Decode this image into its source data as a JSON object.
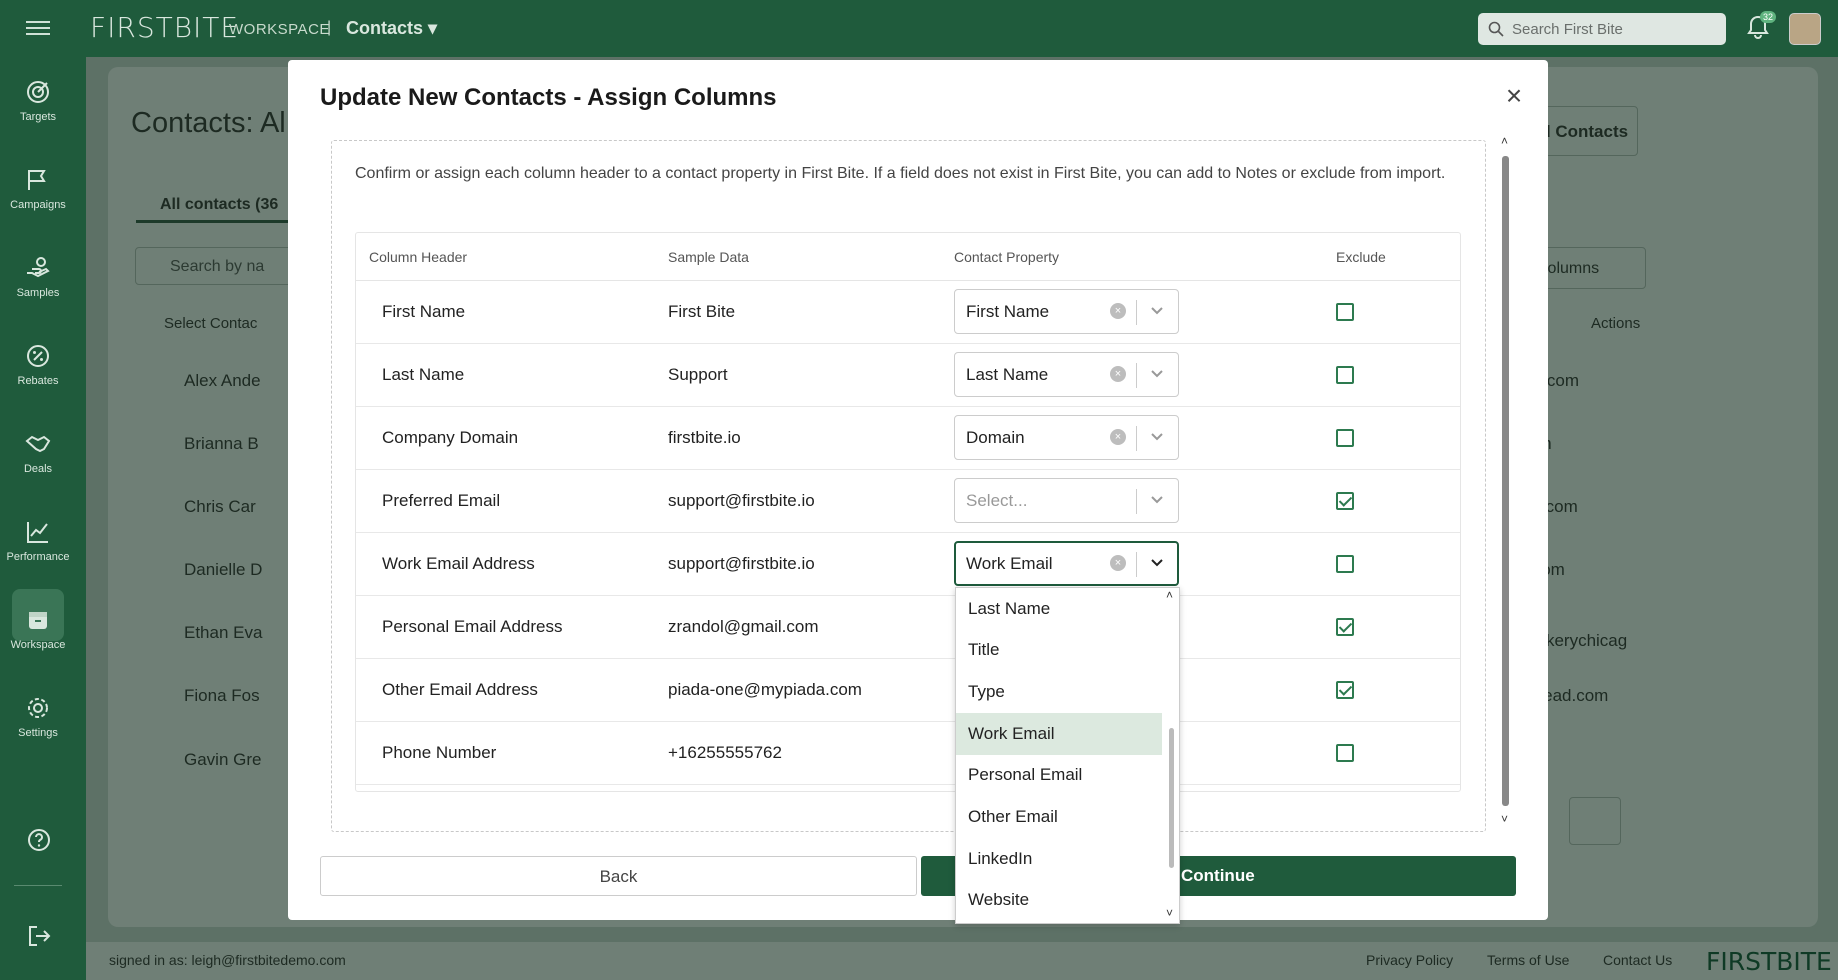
{
  "topbar": {
    "logo": "FIRSTBITE",
    "workspace_label": "WORKSPACE",
    "separator": "|",
    "context": "Contacts",
    "search_placeholder": "Search First Bite",
    "notification_count": "32"
  },
  "sidebar": {
    "items": [
      {
        "label": "Targets",
        "icon": "target-icon"
      },
      {
        "label": "Campaigns",
        "icon": "flag-icon"
      },
      {
        "label": "Samples",
        "icon": "hand-icon"
      },
      {
        "label": "Rebates",
        "icon": "percent-badge-icon"
      },
      {
        "label": "Deals",
        "icon": "handshake-icon"
      },
      {
        "label": "Performance",
        "icon": "chart-icon"
      },
      {
        "label": "Workspace",
        "icon": "archive-icon"
      },
      {
        "label": "Settings",
        "icon": "gear-icon"
      }
    ]
  },
  "background": {
    "page_title": "Contacts: Al",
    "add_contact_label": "tact",
    "upload_label": "Upload Contacts",
    "tab_all": "All contacts (36",
    "search_placeholder": "Search by na",
    "columns_label": "Columns",
    "select_contact": "Select Contac",
    "actions_header": "Actions",
    "names": [
      "Alex Ande",
      "Brianna B",
      "Chris Car",
      "Danielle D",
      "Ethan Eva",
      "Fiona Fos",
      "Gavin Gre"
    ],
    "emails": [
      "ut.com",
      "om",
      "ry.com",
      ".com",
      "cakerychicag",
      "bread.com",
      ""
    ],
    "footer_signed": "signed in as: leigh@firstbitedemo.com",
    "footer_links": [
      "Privacy Policy",
      "Terms of Use",
      "Contact Us"
    ],
    "footer_logo": "FIRSTBITE"
  },
  "modal": {
    "title": "Update New Contacts - Assign Columns",
    "help_text": "Confirm or assign each column header to a contact property in First Bite. If a field does not exist in First Bite, you can add to Notes or exclude from import.",
    "headers": {
      "column": "Column Header",
      "sample": "Sample Data",
      "property": "Contact Property",
      "exclude": "Exclude"
    },
    "rows": [
      {
        "header": "First Name",
        "sample": "First Bite",
        "property": "First Name",
        "excluded": false
      },
      {
        "header": "Last Name",
        "sample": "Support",
        "property": "Last Name",
        "excluded": false
      },
      {
        "header": "Company Domain",
        "sample": "firstbite.io",
        "property": "Domain",
        "excluded": false
      },
      {
        "header": "Preferred Email",
        "sample": "support@firstbite.io",
        "property": "Select...",
        "excluded": true
      },
      {
        "header": "Work Email Address",
        "sample": "support@firstbite.io",
        "property": "Work Email",
        "excluded": false
      },
      {
        "header": "Personal Email Address",
        "sample": "zrandol@gmail.com",
        "property": "",
        "excluded": true
      },
      {
        "header": "Other Email Address",
        "sample": "piada-one@mypiada.com",
        "property": "",
        "excluded": true
      },
      {
        "header": "Phone Number",
        "sample": "+16255555762",
        "property": "",
        "excluded": false
      }
    ],
    "dropdown_options": [
      "Last Name",
      "Title",
      "Type",
      "Work Email",
      "Personal Email",
      "Other Email",
      "LinkedIn",
      "Website"
    ],
    "dropdown_highlight": "Work Email",
    "back_label": "Back",
    "continue_label": "Continue"
  }
}
